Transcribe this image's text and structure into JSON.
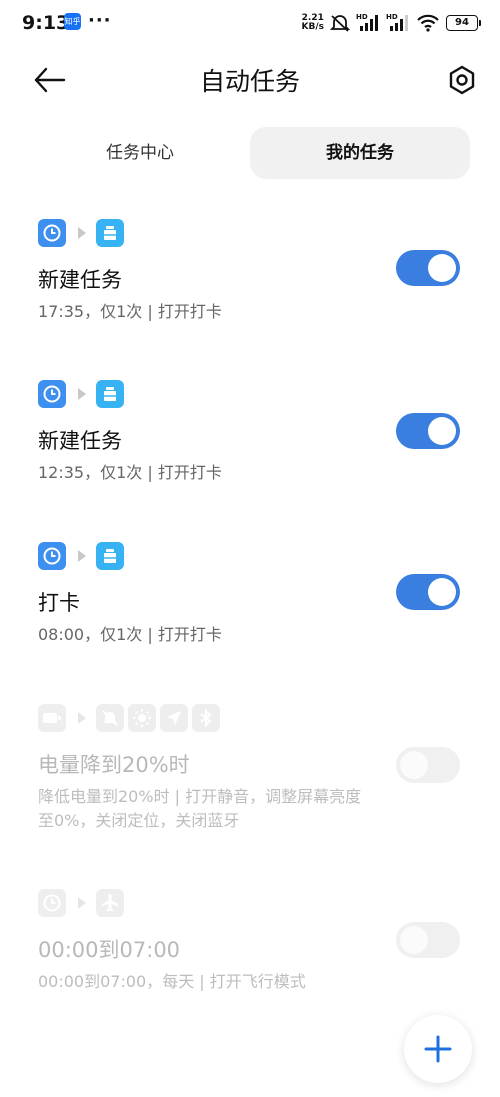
{
  "status_bar": {
    "time": "9:13",
    "app_badge": "知乎",
    "dots": "···",
    "speed_value": "2.21",
    "speed_unit": "KB/s",
    "sim1": "HD",
    "sim2": "HD",
    "battery": "94"
  },
  "header": {
    "title": "自动任务"
  },
  "tabs": [
    {
      "label": "任务中心",
      "active": false
    },
    {
      "label": "我的任务",
      "active": true
    }
  ],
  "tasks": [
    {
      "name": "新建任务",
      "desc": "17:35，仅1次 | 打开打卡",
      "enabled": true,
      "trigger_icon": "clock-icon",
      "action_icons": [
        "app-icon"
      ]
    },
    {
      "name": "新建任务",
      "desc": "12:35，仅1次 | 打开打卡",
      "enabled": true,
      "trigger_icon": "clock-icon",
      "action_icons": [
        "app-icon"
      ]
    },
    {
      "name": "打卡",
      "desc": "08:00，仅1次 | 打开打卡",
      "enabled": true,
      "trigger_icon": "clock-icon",
      "action_icons": [
        "app-icon"
      ]
    },
    {
      "name": "电量降到20%时",
      "desc": "降低电量到20%时 | 打开静音，调整屏幕亮度至0%，关闭定位，关闭蓝牙",
      "enabled": false,
      "trigger_icon": "battery-icon",
      "action_icons": [
        "mute-icon",
        "brightness-icon",
        "location-icon",
        "bluetooth-icon"
      ]
    },
    {
      "name": "00:00到07:00",
      "desc": "00:00到07:00，每天 | 打开飞行模式",
      "enabled": false,
      "trigger_icon": "clock-icon",
      "action_icons": [
        "airplane-icon"
      ]
    }
  ],
  "colors": {
    "accent": "#3a7fe0",
    "toggle_off": "#f0f0f0",
    "icon_blue": "#3d8ff0",
    "icon_cyan": "#37b3f4"
  }
}
